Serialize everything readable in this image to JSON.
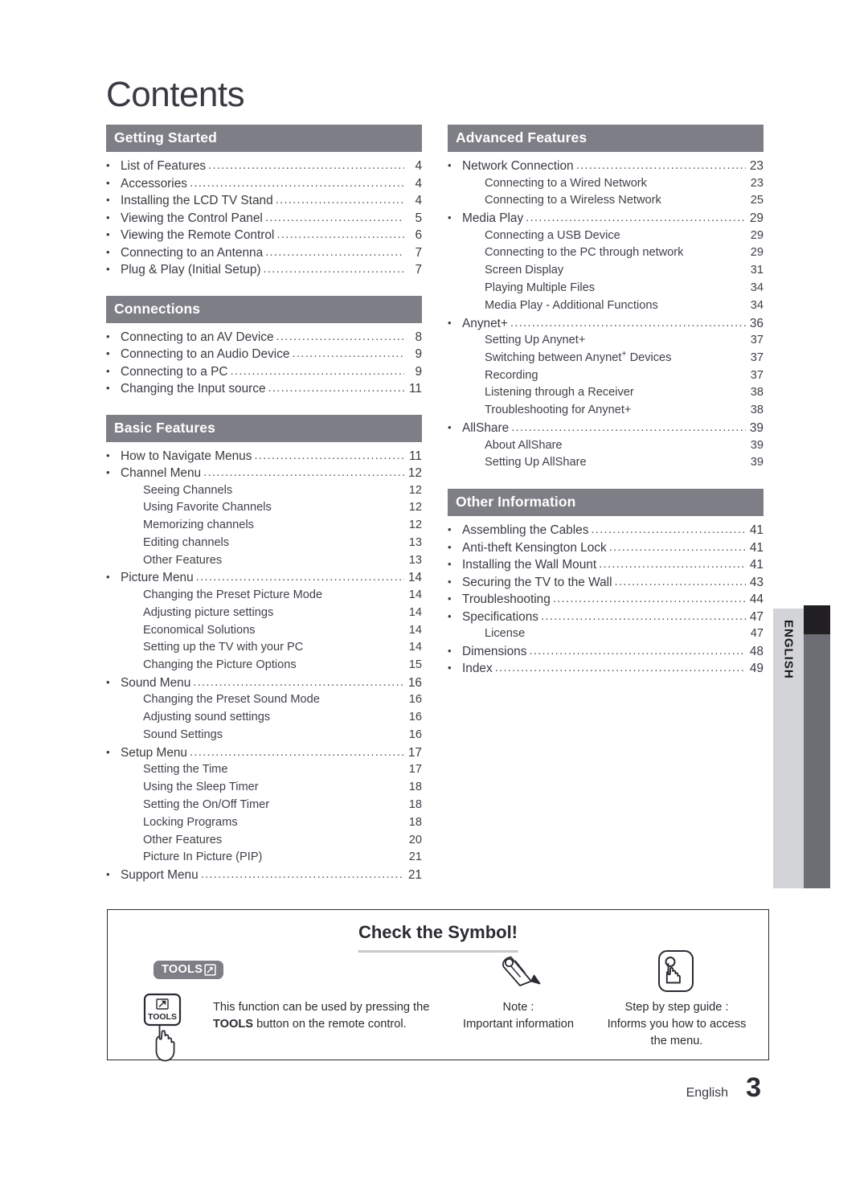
{
  "page": {
    "title": "Contents",
    "footer_language": "English",
    "footer_page_number": "3",
    "side_tab_label": "ENGLISH",
    "accent_header_color": "#7e7e86",
    "side_tab_bg_color": "#d3d4d7",
    "side_bar_gray_color": "#6c6d75",
    "side_bar_black_color": "#221f22"
  },
  "columns": {
    "left": [
      {
        "heading": "Getting Started",
        "entries": [
          {
            "level": 1,
            "label": "List of Features",
            "page": "4"
          },
          {
            "level": 1,
            "label": "Accessories",
            "page": "4"
          },
          {
            "level": 1,
            "label": "Installing the LCD TV Stand",
            "page": "4"
          },
          {
            "level": 1,
            "label": "Viewing the Control Panel",
            "page": "5"
          },
          {
            "level": 1,
            "label": "Viewing the Remote Control",
            "page": "6"
          },
          {
            "level": 1,
            "label": "Connecting to an Antenna",
            "page": "7"
          },
          {
            "level": 1,
            "label": "Plug & Play (Initial Setup)",
            "page": "7"
          }
        ]
      },
      {
        "heading": "Connections",
        "entries": [
          {
            "level": 1,
            "label": "Connecting to an AV Device",
            "page": "8"
          },
          {
            "level": 1,
            "label": "Connecting to an Audio Device",
            "page": "9"
          },
          {
            "level": 1,
            "label": "Connecting to a PC",
            "page": "9"
          },
          {
            "level": 1,
            "label": "Changing the Input source",
            "page": "11"
          }
        ]
      },
      {
        "heading": "Basic Features",
        "entries": [
          {
            "level": 1,
            "label": "How to Navigate Menus",
            "page": "11"
          },
          {
            "level": 1,
            "label": "Channel Menu",
            "page": "12"
          },
          {
            "level": 2,
            "label": "Seeing Channels",
            "page": "12"
          },
          {
            "level": 2,
            "label": "Using Favorite Channels",
            "page": "12"
          },
          {
            "level": 2,
            "label": "Memorizing channels",
            "page": "12"
          },
          {
            "level": 2,
            "label": "Editing channels",
            "page": "13"
          },
          {
            "level": 2,
            "label": "Other Features",
            "page": "13"
          },
          {
            "level": 1,
            "label": "Picture Menu",
            "page": "14"
          },
          {
            "level": 2,
            "label": "Changing the Preset Picture Mode",
            "page": "14"
          },
          {
            "level": 2,
            "label": "Adjusting picture settings",
            "page": "14"
          },
          {
            "level": 2,
            "label": "Economical Solutions",
            "page": "14"
          },
          {
            "level": 2,
            "label": "Setting up the TV with your PC",
            "page": "14"
          },
          {
            "level": 2,
            "label": "Changing the Picture Options",
            "page": "15"
          },
          {
            "level": 1,
            "label": "Sound Menu",
            "page": "16"
          },
          {
            "level": 2,
            "label": "Changing the Preset Sound Mode",
            "page": "16"
          },
          {
            "level": 2,
            "label": "Adjusting sound settings",
            "page": "16"
          },
          {
            "level": 2,
            "label": "Sound Settings",
            "page": "16"
          },
          {
            "level": 1,
            "label": "Setup Menu",
            "page": "17"
          },
          {
            "level": 2,
            "label": "Setting the Time",
            "page": "17"
          },
          {
            "level": 2,
            "label": "Using the Sleep Timer",
            "page": "18"
          },
          {
            "level": 2,
            "label": "Setting the On/Off Timer",
            "page": "18"
          },
          {
            "level": 2,
            "label": "Locking Programs",
            "page": "18"
          },
          {
            "level": 2,
            "label": "Other Features",
            "page": "20"
          },
          {
            "level": 2,
            "label": "Picture In Picture (PIP)",
            "page": "21"
          },
          {
            "level": 1,
            "label": "Support Menu",
            "page": "21"
          }
        ]
      }
    ],
    "right": [
      {
        "heading": "Advanced Features",
        "entries": [
          {
            "level": 1,
            "label": "Network Connection",
            "page": "23"
          },
          {
            "level": 2,
            "label": "Connecting to a Wired Network",
            "page": "23"
          },
          {
            "level": 2,
            "label": "Connecting to a Wireless Network",
            "page": "25"
          },
          {
            "level": 1,
            "label": "Media Play",
            "page": "29"
          },
          {
            "level": 2,
            "label": "Connecting a USB Device",
            "page": "29"
          },
          {
            "level": 2,
            "label": "Connecting to the PC through network",
            "page": "29"
          },
          {
            "level": 2,
            "label": "Screen Display",
            "page": "31"
          },
          {
            "level": 2,
            "label": "Playing Multiple Files",
            "page": "34"
          },
          {
            "level": 2,
            "label": "Media Play - Additional Functions",
            "page": "34"
          },
          {
            "level": 1,
            "label": "Anynet+",
            "page": "36"
          },
          {
            "level": 2,
            "label": "Setting Up Anynet+",
            "page": "37"
          },
          {
            "level": 2,
            "label": "Switching between Anynet+ Devices",
            "page": "37",
            "superscript_plus": true
          },
          {
            "level": 2,
            "label": "Recording",
            "page": "37"
          },
          {
            "level": 2,
            "label": "Listening through a Receiver",
            "page": "38"
          },
          {
            "level": 2,
            "label": "Troubleshooting for Anynet+",
            "page": "38"
          },
          {
            "level": 1,
            "label": "AllShare",
            "page": "39"
          },
          {
            "level": 2,
            "label": "About AllShare",
            "page": "39"
          },
          {
            "level": 2,
            "label": "Setting Up AllShare",
            "page": "39"
          }
        ]
      },
      {
        "heading": "Other Information",
        "entries": [
          {
            "level": 1,
            "label": "Assembling the Cables",
            "page": "41"
          },
          {
            "level": 1,
            "label": "Anti-theft Kensington Lock",
            "page": "41"
          },
          {
            "level": 1,
            "label": "Installing the Wall Mount",
            "page": "41"
          },
          {
            "level": 1,
            "label": "Securing the TV to the Wall",
            "page": "43"
          },
          {
            "level": 1,
            "label": "Troubleshooting",
            "page": "44"
          },
          {
            "level": 1,
            "label": "Specifications",
            "page": "47"
          },
          {
            "level": 2,
            "label": "License",
            "page": "47"
          },
          {
            "level": 1,
            "label": "Dimensions",
            "page": "48"
          },
          {
            "level": 1,
            "label": "Index",
            "page": "49"
          }
        ]
      }
    ]
  },
  "symbol_box": {
    "title": "Check the Symbol!",
    "items": [
      {
        "icon": "tools-badge-icon",
        "badge_text": "TOOLS",
        "description_part1": "This function can be used by pressing the ",
        "description_bold": "TOOLS",
        "description_part2": " button on the remote control.",
        "remote_button_label": "TOOLS"
      },
      {
        "icon": "pencil-note-icon",
        "title": "Note :",
        "description": "Important information"
      },
      {
        "icon": "step-by-step-hand-icon",
        "title": "Step by step guide :",
        "description": "Informs you how to access the menu."
      }
    ]
  }
}
